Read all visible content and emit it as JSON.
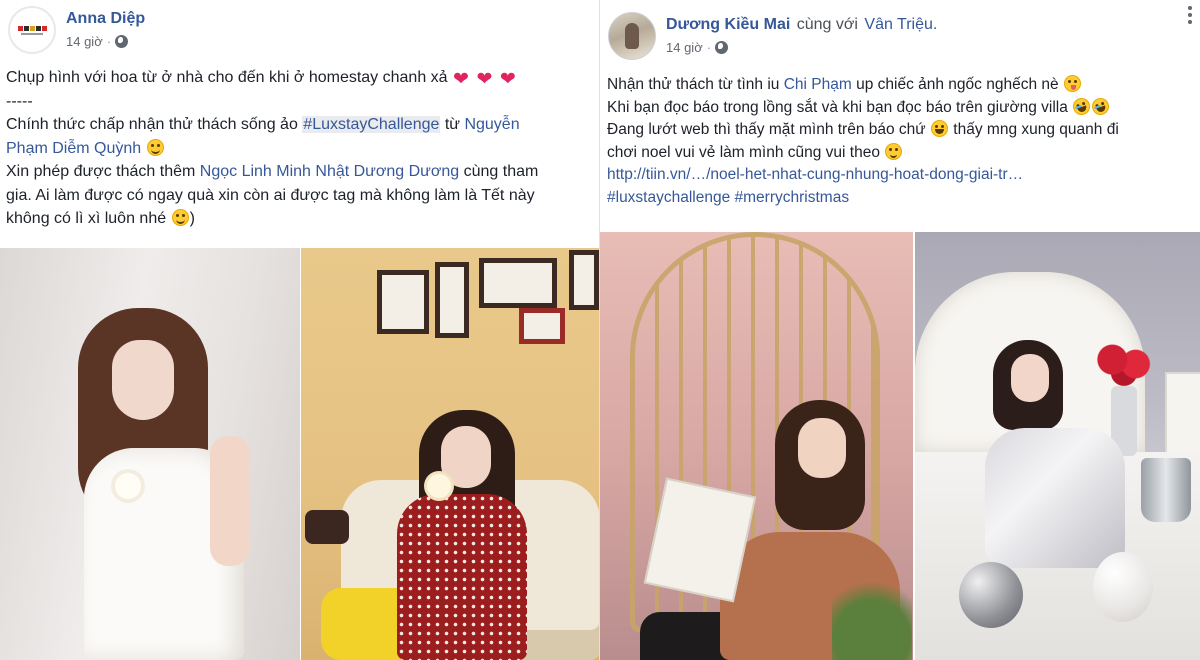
{
  "left_post": {
    "author": "Anna Diệp",
    "time": "14 giờ",
    "dot": "·",
    "lines": [
      {
        "text": "Chụp hình với hoa từ ở nhà cho đến khi ở homestay chanh xả "
      },
      {
        "text": "-----"
      },
      {
        "prefix": "Chính thức chấp nhận thử thách sống ảo ",
        "tag": "#LuxstayChallenge",
        "mid": " từ ",
        "link": "Nguyễn"
      },
      {
        "link": "Phạm Diễm Quỳnh"
      },
      {
        "prefix": "Xin phép được thách thêm ",
        "link": "Ngọc Linh Minh Nhật Dương Dương",
        "suffix": " cùng tham"
      },
      {
        "text": "gia. Ai làm được có ngay quà xin còn ai được tag mà không làm là Tết này"
      },
      {
        "text": "không có lì xì luôn nhé "
      },
      {
        "suffix": ")"
      }
    ],
    "photos": [
      {
        "alt": "Girl in white dress holding flower"
      },
      {
        "alt": "Girl in red polka dot dress on sofa"
      }
    ]
  },
  "right_post": {
    "author": "Dương Kiều Mai",
    "with_word": "cùng với",
    "with_name": "Vân Triệu.",
    "time": "14 giờ",
    "dot": "·",
    "lines": [
      {
        "prefix": "Nhận thử thách từ tình iu ",
        "link": "Chi Phạm",
        "suffix": " up chiếc ảnh ngốc nghếch nè "
      },
      {
        "text": "Khi bạn đọc báo trong lồng sắt và khi bạn đọc báo trên giường villa "
      },
      {
        "prefix": "Đang lướt web thì thấy mặt mình trên báo chứ ",
        "suffix": " thấy mng xung quanh đi"
      },
      {
        "text": "chơi noel vui vẻ làm mình cũng vui theo "
      },
      {
        "url": "http://tiin.vn/…/noel-het-nhat-cung-nhung-hoat-dong-giai-tr…"
      },
      {
        "tags": "#luxstaychallenge #merrychristmas"
      }
    ],
    "photos": [
      {
        "alt": "Girl reading magazine in golden cage chair"
      },
      {
        "alt": "Girl in silver dress on white bed with roses"
      }
    ]
  },
  "icons": {
    "heart": "❤"
  },
  "colors": {
    "link": "#365899",
    "text": "#1d2129",
    "meta": "#616770"
  }
}
